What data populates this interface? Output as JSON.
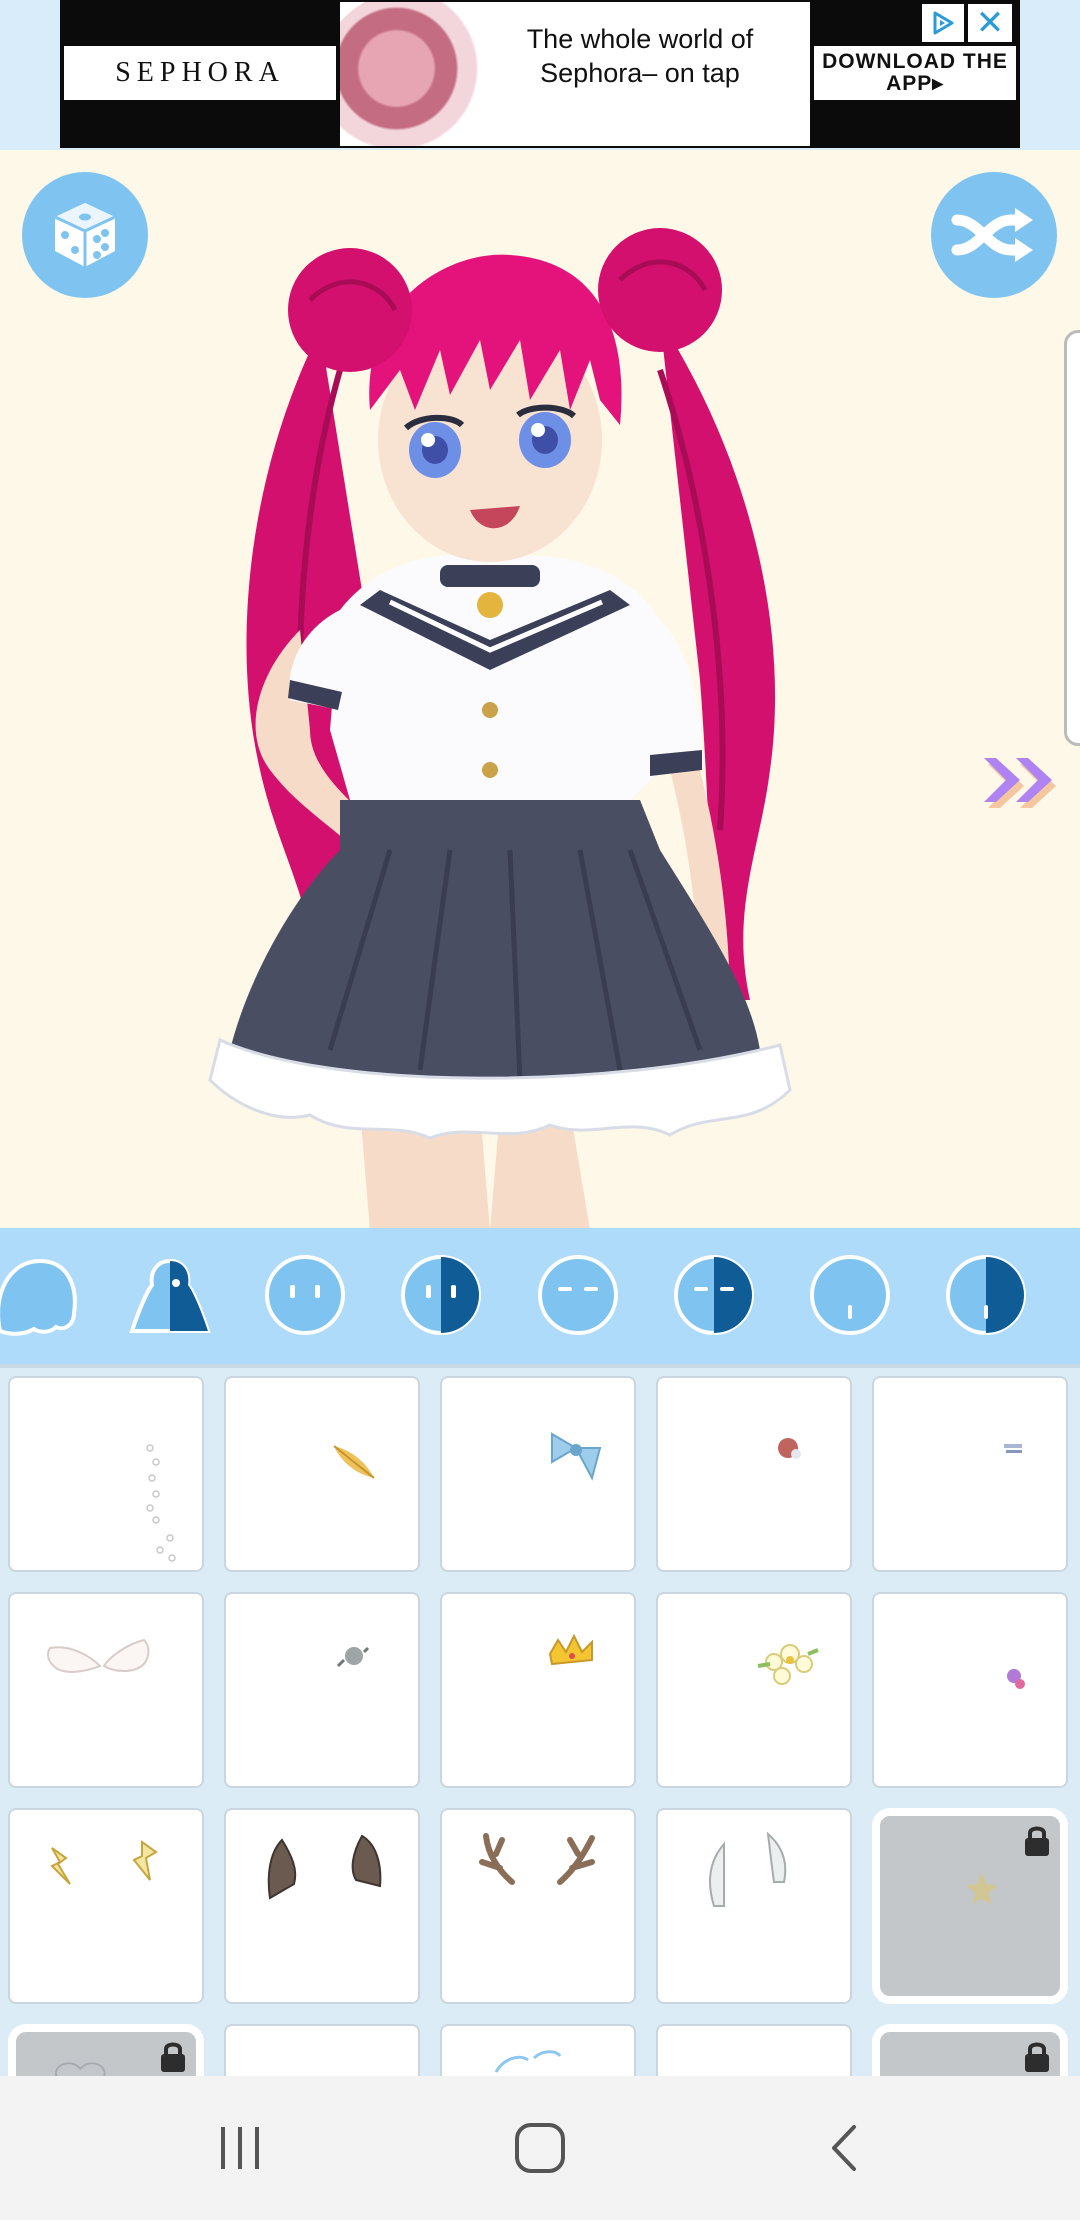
{
  "ad": {
    "brand": "SEPHORA",
    "headline": "The whole world of Sephora– on tap",
    "cta": "DOWNLOAD THE APP▸",
    "close_glyph": "✕",
    "choices_icon": "ad-choices-icon"
  },
  "stage": {
    "buttons": [
      {
        "name": "random-dice-button",
        "icon": "dice-icon"
      },
      {
        "name": "shuffle-button",
        "icon": "shuffle-icon"
      }
    ],
    "next_icon": "double-chevron-right-icon",
    "accent_color": "#7fc4f0",
    "arrow_color": "#b083f2"
  },
  "tabs": [
    {
      "name": "tab-hair-front",
      "icon": "hair-front-icon"
    },
    {
      "name": "tab-hair-back",
      "icon": "hair-back-icon"
    },
    {
      "name": "tab-eyes",
      "icon": "eyes-icon"
    },
    {
      "name": "tab-eyes-color",
      "icon": "eyes-half-icon"
    },
    {
      "name": "tab-brows",
      "icon": "brows-icon"
    },
    {
      "name": "tab-brows-color",
      "icon": "brows-half-icon"
    },
    {
      "name": "tab-mouth",
      "icon": "mouth-icon"
    },
    {
      "name": "tab-mouth-color",
      "icon": "mouth-half-icon"
    }
  ],
  "accessories": [
    {
      "icon": "hair-pearls-icon",
      "locked": false
    },
    {
      "icon": "golden-leaf-clip-icon",
      "locked": false
    },
    {
      "icon": "blue-bow-icon",
      "locked": false
    },
    {
      "icon": "red-flower-clip-icon",
      "locked": false
    },
    {
      "icon": "hair-pin-icon",
      "locked": false
    },
    {
      "icon": "white-wings-icon",
      "locked": false
    },
    {
      "icon": "silver-rose-icon",
      "locked": false
    },
    {
      "icon": "gold-crown-icon",
      "locked": false
    },
    {
      "icon": "flower-crown-icon",
      "locked": false
    },
    {
      "icon": "pink-bead-clip-icon",
      "locked": false
    },
    {
      "icon": "lightning-clips-icon",
      "locked": false
    },
    {
      "icon": "cat-ears-icon",
      "locked": false
    },
    {
      "icon": "antlers-icon",
      "locked": false
    },
    {
      "icon": "horns-icon",
      "locked": false
    },
    {
      "icon": "star-clip-icon",
      "locked": true
    },
    {
      "icon": "heart-clip-icon",
      "locked": true
    },
    {
      "icon": "empty-slot-icon",
      "locked": false
    },
    {
      "icon": "blue-wings-icon",
      "locked": false
    },
    {
      "icon": "empty-slot-icon",
      "locked": false
    },
    {
      "icon": "bead-clip-icon",
      "locked": true
    }
  ],
  "navbar": [
    {
      "name": "recents-button",
      "icon": "recents-icon"
    },
    {
      "name": "home-button",
      "icon": "home-icon"
    },
    {
      "name": "back-button",
      "icon": "back-icon"
    }
  ]
}
